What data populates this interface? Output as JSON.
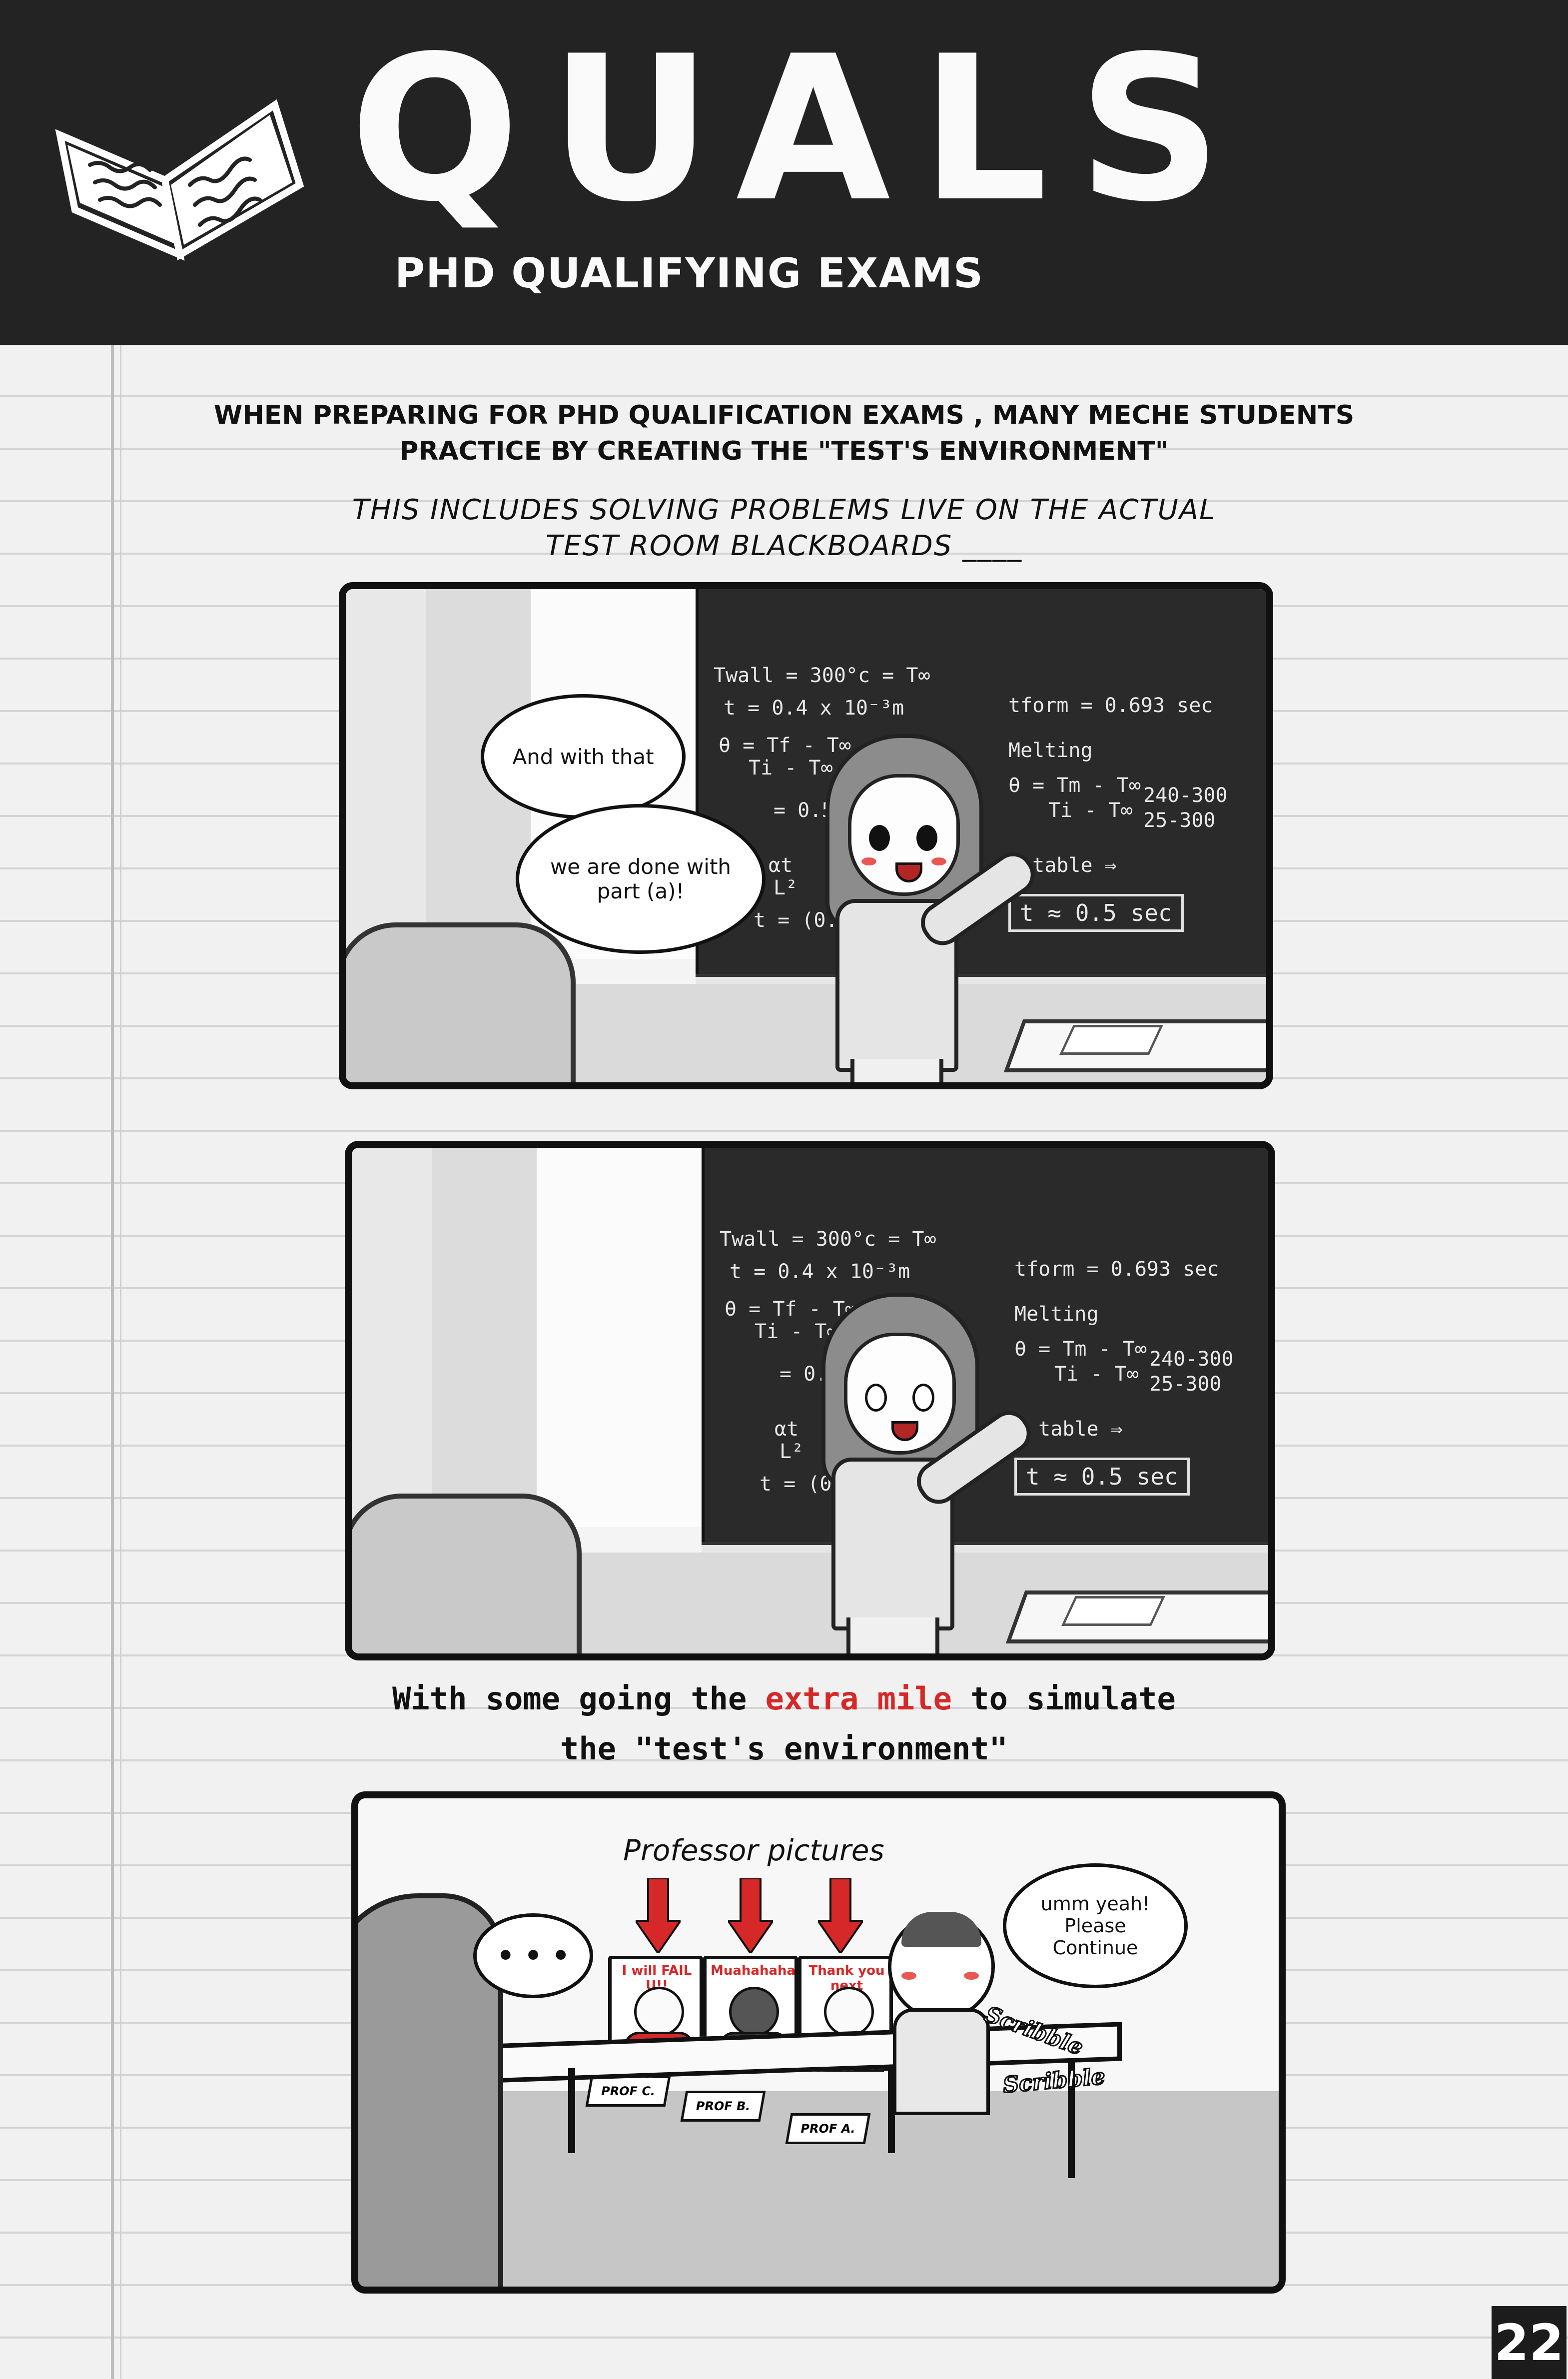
{
  "header": {
    "title": "QUALS",
    "subtitle": "PHD QUALIFYING EXAMS",
    "icon": "open-book-icon"
  },
  "intro": {
    "line1": "WHEN PREPARING FOR PHD QUALIFICATION EXAMS , MANY MECHE STUDENTS",
    "line2": "PRACTICE BY CREATING THE \"TEST'S ENVIRONMENT\"",
    "line3": "THIS INCLUDES SOLVING PROBLEMS LIVE ON THE ACTUAL",
    "line4": "TEST ROOM BLACKBOARDS ____"
  },
  "blackboard": {
    "eq1": "Twall = 300°c = T∞",
    "eq2": "t = 0.4 x 10⁻³m",
    "eq3": "θ = Tf - T∞",
    "eq3b": "Ti - T∞",
    "eq4": "= 0.5",
    "eq5": "αt",
    "eq5b": "L²",
    "eq6": "t = (0.5)(",
    "r1": "tform = 0.693 sec",
    "r2": "Melting",
    "r3": "θ = Tm - T∞",
    "r3b": "Ti - T∞",
    "r4a": "240-300",
    "r4b": "25-300",
    "r5": "↳ table ⇒",
    "result": "t ≈ 0.5 sec"
  },
  "panel1": {
    "bubble_top": "And with that",
    "bubble_bottom": "we are done with part (a)!"
  },
  "caption": {
    "before": "With some going the ",
    "accent": "extra mile",
    "after": " to simulate",
    "line2": "the \"test's environment\""
  },
  "panel3": {
    "annotation": "Professor pictures",
    "ellipsis": "• • •",
    "bubble_right": "umm yeah! Please Continue",
    "sfx1": "Scribble",
    "sfx2": "Scribble",
    "posters": [
      {
        "text": "I will FAIL U!!",
        "plate": "PROF C."
      },
      {
        "text": "Muahahaha",
        "plate": "PROF B."
      },
      {
        "text": "Thank you next",
        "plate": "PROF A."
      }
    ]
  },
  "colors": {
    "accent_red": "#d62828",
    "header_bg": "#232323",
    "board": "#2a2a2a"
  },
  "page_number": "22"
}
